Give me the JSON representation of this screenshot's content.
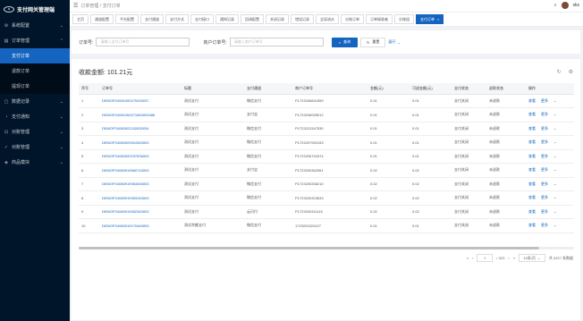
{
  "app": {
    "title": "支付网关管理端"
  },
  "sidebar": {
    "items": [
      {
        "label": "系统配置"
      },
      {
        "label": "订单管理"
      },
      {
        "label": "数据记录"
      },
      {
        "label": "支付通知"
      },
      {
        "label": "对账管理"
      },
      {
        "label": "对账管理"
      },
      {
        "label": "商品模块"
      }
    ],
    "sub_items": [
      {
        "label": "支付订单"
      },
      {
        "label": "退款订单"
      },
      {
        "label": "提现订单"
      }
    ]
  },
  "header": {
    "breadcrumb_1": "订单管理",
    "breadcrumb_2": "支付订单",
    "username": "sks"
  },
  "tabs": [
    {
      "label": "主页"
    },
    {
      "label": "通道配置"
    },
    {
      "label": "平台配置"
    },
    {
      "label": "支付通道"
    },
    {
      "label": "支付方式"
    },
    {
      "label": "支付接口"
    },
    {
      "label": "通知记录"
    },
    {
      "label": "回调配置"
    },
    {
      "label": "关闭记录"
    },
    {
      "label": "错误记录"
    },
    {
      "label": "全局流水"
    },
    {
      "label": "分账订单"
    },
    {
      "label": "订单接收者"
    },
    {
      "label": "分账组"
    },
    {
      "label": "支付订单"
    }
  ],
  "search": {
    "order_label": "订单号:",
    "order_placeholder": "请输入支付订单号",
    "merchant_label": "商户订单号:",
    "merchant_placeholder": "请输入商户订单号",
    "search_btn": "查询",
    "reset_btn": "重置",
    "expand": "展开"
  },
  "summary": {
    "text": "收款金额: 101.21元"
  },
  "table": {
    "headers": [
      "序号",
      "订单号",
      "标题",
      "支付通道",
      "商户订单号",
      "金额(元)",
      "可退金额(元)",
      "支付状态",
      "退款状态",
      "操作"
    ],
    "rows": [
      [
        "1",
        "DEMOP24081000275430037",
        "测试支付",
        "微信支付",
        "P1723206841559",
        "0.01",
        "0.01",
        "支付关闭",
        "未退款",
        "查看",
        "更多"
      ],
      [
        "2",
        "DEMOP24081000271663003486",
        "测试支付",
        "支付宝",
        "P1723206055012",
        "0.01",
        "0.01",
        "支付关闭",
        "未退款",
        "查看",
        "更多"
      ],
      [
        "3",
        "DEMOP24080922242630034",
        "测试支付",
        "微信支付",
        "P1723213347530",
        "0.01",
        "0.01",
        "支付关闭",
        "未退款",
        "查看",
        "更多"
      ],
      [
        "4",
        "DEMOP24080920524363003",
        "测试支付",
        "微信支付",
        "P1723207952153",
        "0.01",
        "0.01",
        "支付关闭",
        "未退款",
        "查看",
        "更多"
      ],
      [
        "5",
        "DEMOP24080920237636003",
        "测试支付",
        "微信支付",
        "P1723206754374",
        "0.01",
        "0.01",
        "支付关闭",
        "未退款",
        "查看",
        "更多"
      ],
      [
        "6",
        "DEMOP24080919560743003",
        "测试支付",
        "支付宝",
        "P1723200362961",
        "0.02",
        "0.02",
        "支付关闭",
        "未退款",
        "查看",
        "更多"
      ],
      [
        "7",
        "DEMOP24080919354063003",
        "测试支付",
        "微信支付",
        "P1723200336210",
        "0.02",
        "0.02",
        "支付关闭",
        "未退款",
        "查看",
        "更多"
      ],
      [
        "8",
        "DEMOP24080919353163003",
        "测试支付",
        "微信支付",
        "P1723200323633",
        "0.02",
        "0.02",
        "支付关闭",
        "未退款",
        "查看",
        "更多"
      ],
      [
        "9",
        "DEMOP24080919352363003",
        "测试支付",
        "云闪付",
        "P1723200311115",
        "0.02",
        "0.02",
        "支付关闭",
        "未退款",
        "查看",
        "更多"
      ],
      [
        "10",
        "DEMOP24080919170463003",
        "测试余额支付",
        "微信支付",
        "1723200222427",
        "0.01",
        "0.01",
        "支付关闭",
        "未退款",
        "查看",
        "更多"
      ]
    ]
  },
  "pager": {
    "current": "1",
    "total_pages": "/ 323",
    "page_size": "10条/页",
    "total": "共 3227 条数据"
  }
}
